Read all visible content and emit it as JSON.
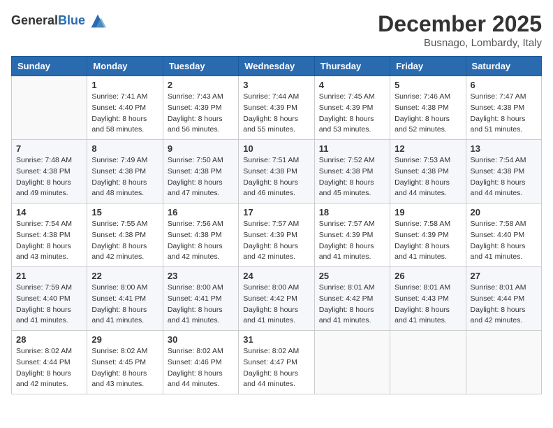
{
  "logo": {
    "general": "General",
    "blue": "Blue"
  },
  "header": {
    "month": "December 2025",
    "location": "Busnago, Lombardy, Italy"
  },
  "days_of_week": [
    "Sunday",
    "Monday",
    "Tuesday",
    "Wednesday",
    "Thursday",
    "Friday",
    "Saturday"
  ],
  "weeks": [
    [
      {
        "day": "",
        "info": ""
      },
      {
        "day": "1",
        "info": "Sunrise: 7:41 AM\nSunset: 4:40 PM\nDaylight: 8 hours\nand 58 minutes."
      },
      {
        "day": "2",
        "info": "Sunrise: 7:43 AM\nSunset: 4:39 PM\nDaylight: 8 hours\nand 56 minutes."
      },
      {
        "day": "3",
        "info": "Sunrise: 7:44 AM\nSunset: 4:39 PM\nDaylight: 8 hours\nand 55 minutes."
      },
      {
        "day": "4",
        "info": "Sunrise: 7:45 AM\nSunset: 4:39 PM\nDaylight: 8 hours\nand 53 minutes."
      },
      {
        "day": "5",
        "info": "Sunrise: 7:46 AM\nSunset: 4:38 PM\nDaylight: 8 hours\nand 52 minutes."
      },
      {
        "day": "6",
        "info": "Sunrise: 7:47 AM\nSunset: 4:38 PM\nDaylight: 8 hours\nand 51 minutes."
      }
    ],
    [
      {
        "day": "7",
        "info": "Sunrise: 7:48 AM\nSunset: 4:38 PM\nDaylight: 8 hours\nand 49 minutes."
      },
      {
        "day": "8",
        "info": "Sunrise: 7:49 AM\nSunset: 4:38 PM\nDaylight: 8 hours\nand 48 minutes."
      },
      {
        "day": "9",
        "info": "Sunrise: 7:50 AM\nSunset: 4:38 PM\nDaylight: 8 hours\nand 47 minutes."
      },
      {
        "day": "10",
        "info": "Sunrise: 7:51 AM\nSunset: 4:38 PM\nDaylight: 8 hours\nand 46 minutes."
      },
      {
        "day": "11",
        "info": "Sunrise: 7:52 AM\nSunset: 4:38 PM\nDaylight: 8 hours\nand 45 minutes."
      },
      {
        "day": "12",
        "info": "Sunrise: 7:53 AM\nSunset: 4:38 PM\nDaylight: 8 hours\nand 44 minutes."
      },
      {
        "day": "13",
        "info": "Sunrise: 7:54 AM\nSunset: 4:38 PM\nDaylight: 8 hours\nand 44 minutes."
      }
    ],
    [
      {
        "day": "14",
        "info": "Sunrise: 7:54 AM\nSunset: 4:38 PM\nDaylight: 8 hours\nand 43 minutes."
      },
      {
        "day": "15",
        "info": "Sunrise: 7:55 AM\nSunset: 4:38 PM\nDaylight: 8 hours\nand 42 minutes."
      },
      {
        "day": "16",
        "info": "Sunrise: 7:56 AM\nSunset: 4:38 PM\nDaylight: 8 hours\nand 42 minutes."
      },
      {
        "day": "17",
        "info": "Sunrise: 7:57 AM\nSunset: 4:39 PM\nDaylight: 8 hours\nand 42 minutes."
      },
      {
        "day": "18",
        "info": "Sunrise: 7:57 AM\nSunset: 4:39 PM\nDaylight: 8 hours\nand 41 minutes."
      },
      {
        "day": "19",
        "info": "Sunrise: 7:58 AM\nSunset: 4:39 PM\nDaylight: 8 hours\nand 41 minutes."
      },
      {
        "day": "20",
        "info": "Sunrise: 7:58 AM\nSunset: 4:40 PM\nDaylight: 8 hours\nand 41 minutes."
      }
    ],
    [
      {
        "day": "21",
        "info": "Sunrise: 7:59 AM\nSunset: 4:40 PM\nDaylight: 8 hours\nand 41 minutes."
      },
      {
        "day": "22",
        "info": "Sunrise: 8:00 AM\nSunset: 4:41 PM\nDaylight: 8 hours\nand 41 minutes."
      },
      {
        "day": "23",
        "info": "Sunrise: 8:00 AM\nSunset: 4:41 PM\nDaylight: 8 hours\nand 41 minutes."
      },
      {
        "day": "24",
        "info": "Sunrise: 8:00 AM\nSunset: 4:42 PM\nDaylight: 8 hours\nand 41 minutes."
      },
      {
        "day": "25",
        "info": "Sunrise: 8:01 AM\nSunset: 4:42 PM\nDaylight: 8 hours\nand 41 minutes."
      },
      {
        "day": "26",
        "info": "Sunrise: 8:01 AM\nSunset: 4:43 PM\nDaylight: 8 hours\nand 41 minutes."
      },
      {
        "day": "27",
        "info": "Sunrise: 8:01 AM\nSunset: 4:44 PM\nDaylight: 8 hours\nand 42 minutes."
      }
    ],
    [
      {
        "day": "28",
        "info": "Sunrise: 8:02 AM\nSunset: 4:44 PM\nDaylight: 8 hours\nand 42 minutes."
      },
      {
        "day": "29",
        "info": "Sunrise: 8:02 AM\nSunset: 4:45 PM\nDaylight: 8 hours\nand 43 minutes."
      },
      {
        "day": "30",
        "info": "Sunrise: 8:02 AM\nSunset: 4:46 PM\nDaylight: 8 hours\nand 44 minutes."
      },
      {
        "day": "31",
        "info": "Sunrise: 8:02 AM\nSunset: 4:47 PM\nDaylight: 8 hours\nand 44 minutes."
      },
      {
        "day": "",
        "info": ""
      },
      {
        "day": "",
        "info": ""
      },
      {
        "day": "",
        "info": ""
      }
    ]
  ]
}
